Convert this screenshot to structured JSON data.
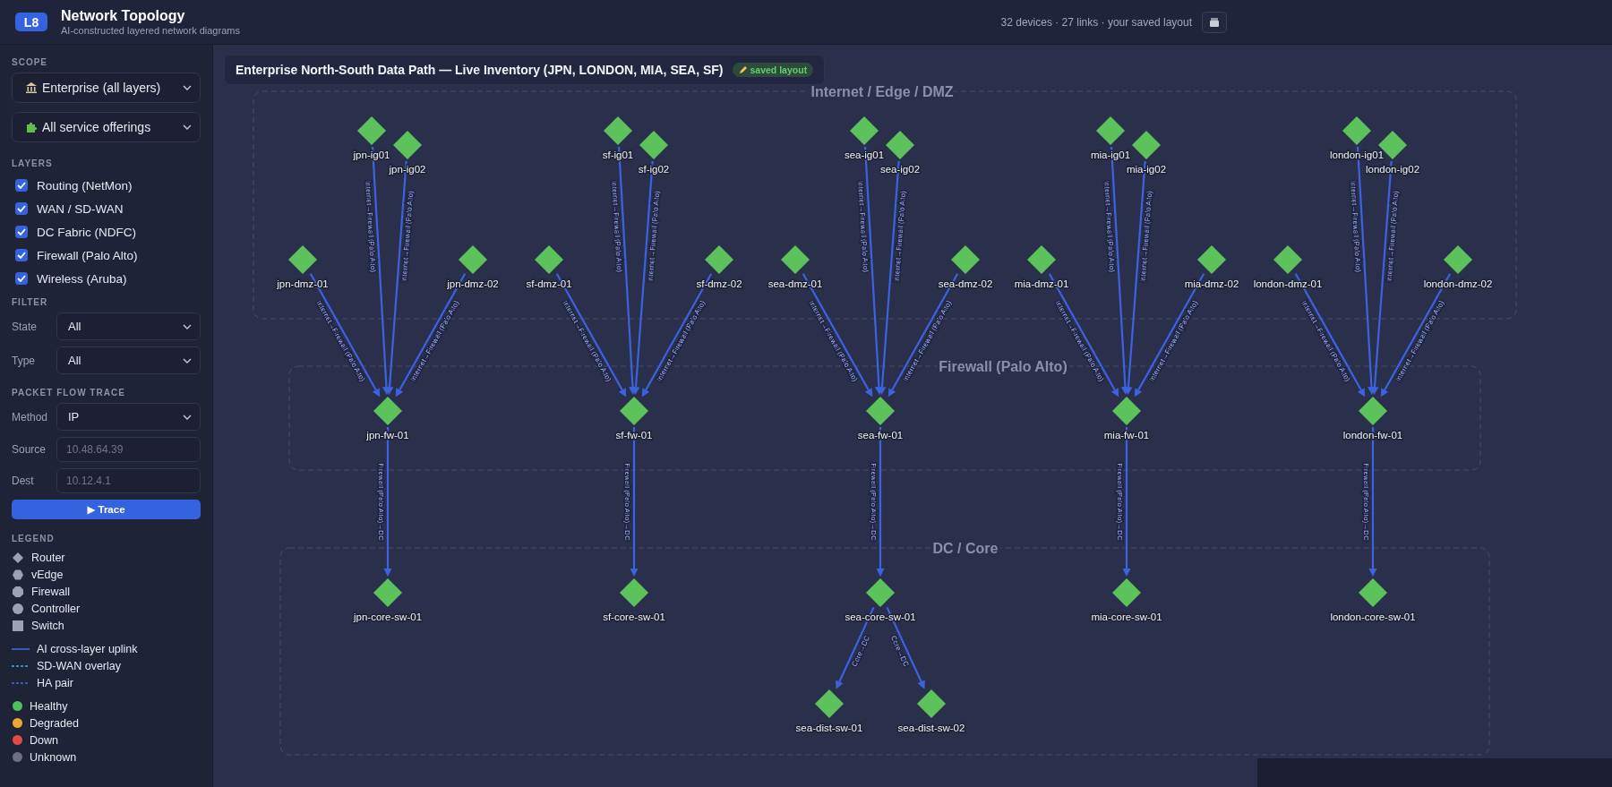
{
  "header": {
    "badge": "L8",
    "title": "Network Topology",
    "subtitle": "AI-constructed layered network diagrams",
    "stats": "32 devices · 27 links · your saved layout"
  },
  "sidebar": {
    "scope": {
      "heading": "SCOPE",
      "dropdowns": [
        {
          "kind": "scope",
          "value": "Enterprise (all layers)"
        },
        {
          "kind": "service",
          "value": "All service offerings"
        }
      ]
    },
    "layers": {
      "heading": "LAYERS",
      "items": [
        {
          "label": "Routing (NetMon)",
          "checked": true
        },
        {
          "label": "WAN / SD-WAN",
          "checked": true
        },
        {
          "label": "DC Fabric (NDFC)",
          "checked": true
        },
        {
          "label": "Firewall (Palo Alto)",
          "checked": true
        },
        {
          "label": "Wireless (Aruba)",
          "checked": true
        }
      ]
    },
    "filter": {
      "heading": "FILTER",
      "fields": [
        {
          "label": "State",
          "value": "All"
        },
        {
          "label": "Type",
          "value": "All"
        }
      ]
    },
    "trace": {
      "heading": "PACKET FLOW TRACE",
      "method": {
        "label": "Method",
        "value": "IP"
      },
      "inputs": [
        {
          "label": "Source",
          "placeholder": "10.48.64.39"
        },
        {
          "label": "Dest",
          "placeholder": "10.12.4.1"
        }
      ],
      "button": "▶ Trace"
    },
    "legend": {
      "heading": "LEGEND",
      "shapes": [
        {
          "kind": "router",
          "label": "Router"
        },
        {
          "kind": "vedge",
          "label": "vEdge"
        },
        {
          "kind": "firewall",
          "label": "Firewall"
        },
        {
          "kind": "controller",
          "label": "Controller"
        },
        {
          "kind": "switch",
          "label": "Switch"
        }
      ],
      "lines": [
        {
          "kind": "uplink",
          "label": "AI cross-layer uplink"
        },
        {
          "kind": "overlay",
          "label": "SD-WAN overlay"
        },
        {
          "kind": "ha",
          "label": "HA pair"
        }
      ],
      "states": [
        {
          "label": "Healthy",
          "color": "#4cc35a"
        },
        {
          "label": "Degraded",
          "color": "#f0a232"
        },
        {
          "label": "Down",
          "color": "#e24b41"
        },
        {
          "label": "Unknown",
          "color": "#6b7183"
        }
      ]
    }
  },
  "canvas": {
    "title": "Enterprise North-South Data Path — Live Inventory (JPN, LONDON, MIA, SEA, SF)",
    "badge": "saved layout",
    "zones": [
      {
        "kind": "edge",
        "title": "Internet / Edge / DMZ"
      },
      {
        "kind": "firewall",
        "title": "Firewall (Palo Alto)"
      },
      {
        "kind": "core",
        "title": "DC / Core"
      }
    ],
    "sites": [
      {
        "firewall": {
          "name": "jpn-fw-01",
          "kind": "fw",
          "color": "#5cc35c",
          "sources": [
            {
              "name": "jpn-ig01",
              "kind": "ig",
              "color": "#5cc35c",
              "link_label": "Internet→Firewall (Palo Alto)"
            },
            {
              "name": "jpn-ig02",
              "kind": "ig",
              "color": "#5cc35c",
              "link_label": "Internet→Firewall (Palo Alto)"
            },
            {
              "name": "jpn-dmz-01",
              "kind": "dmz",
              "color": "#5cc35c",
              "link_label": "Internet→Firewall (Palo Alto)"
            },
            {
              "name": "jpn-dmz-02",
              "kind": "dmz",
              "color": "#5cc35c",
              "link_label": "Internet→Firewall (Palo Alto)"
            }
          ],
          "targets": [
            {
              "name": "jpn-core-sw-01",
              "kind": "core",
              "color": "#5cc35c",
              "link_label": "Firewall (Palo Alto)→DC"
            }
          ]
        }
      },
      {
        "firewall": {
          "name": "sf-fw-01",
          "kind": "fw",
          "color": "#5cc35c",
          "sources": [
            {
              "name": "sf-ig01",
              "kind": "ig",
              "color": "#5cc35c",
              "link_label": "Internet→Firewall (Palo Alto)"
            },
            {
              "name": "sf-ig02",
              "kind": "ig",
              "color": "#5cc35c",
              "link_label": "Internet→Firewall (Palo Alto)"
            },
            {
              "name": "sf-dmz-01",
              "kind": "dmz",
              "color": "#5cc35c",
              "link_label": "Internet→Firewall (Palo Alto)"
            },
            {
              "name": "sf-dmz-02",
              "kind": "dmz",
              "color": "#5cc35c",
              "link_label": "Internet→Firewall (Palo Alto)"
            }
          ],
          "targets": [
            {
              "name": "sf-core-sw-01",
              "kind": "core",
              "color": "#5cc35c",
              "link_label": "Firewall (Palo Alto)→DC"
            }
          ]
        }
      },
      {
        "firewall": {
          "name": "sea-fw-01",
          "kind": "fw",
          "color": "#5cc35c",
          "sources": [
            {
              "name": "sea-ig01",
              "kind": "ig",
              "color": "#5cc35c",
              "link_label": "Internet→Firewall (Palo Alto)"
            },
            {
              "name": "sea-ig02",
              "kind": "ig",
              "color": "#5cc35c",
              "link_label": "Internet→Firewall (Palo Alto)"
            },
            {
              "name": "sea-dmz-01",
              "kind": "dmz",
              "color": "#5cc35c",
              "link_label": "Internet→Firewall (Palo Alto)"
            },
            {
              "name": "sea-dmz-02",
              "kind": "dmz",
              "color": "#5cc35c",
              "link_label": "Internet→Firewall (Palo Alto)"
            }
          ],
          "targets": [
            {
              "name": "sea-core-sw-01",
              "kind": "core",
              "color": "#5cc35c",
              "link_label": "Firewall (Palo Alto)→DC",
              "targets": [
                {
                  "name": "sea-dist-sw-01",
                  "kind": "dist",
                  "color": "#5cc35c",
                  "link_label": "Core→DC"
                },
                {
                  "name": "sea-dist-sw-02",
                  "kind": "dist",
                  "color": "#5cc35c",
                  "link_label": "Core→DC"
                }
              ]
            }
          ]
        }
      },
      {
        "firewall": {
          "name": "mia-fw-01",
          "kind": "fw",
          "color": "#5cc35c",
          "sources": [
            {
              "name": "mia-ig01",
              "kind": "ig",
              "color": "#5cc35c",
              "link_label": "Internet→Firewall (Palo Alto)"
            },
            {
              "name": "mia-ig02",
              "kind": "ig",
              "color": "#5cc35c",
              "link_label": "Internet→Firewall (Palo Alto)"
            },
            {
              "name": "mia-dmz-01",
              "kind": "dmz",
              "color": "#5cc35c",
              "link_label": "Internet→Firewall (Palo Alto)"
            },
            {
              "name": "mia-dmz-02",
              "kind": "dmz",
              "color": "#5cc35c",
              "link_label": "Internet→Firewall (Palo Alto)"
            }
          ],
          "targets": [
            {
              "name": "mia-core-sw-01",
              "kind": "core",
              "color": "#5cc35c",
              "link_label": "Firewall (Palo Alto)→DC"
            }
          ]
        }
      },
      {
        "firewall": {
          "name": "london-fw-01",
          "kind": "fw",
          "color": "#5cc35c",
          "sources": [
            {
              "name": "london-ig01",
              "kind": "ig",
              "color": "#5cc35c",
              "link_label": "Internet→Firewall (Palo Alto)"
            },
            {
              "name": "london-ig02",
              "kind": "ig",
              "color": "#5cc35c",
              "link_label": "Internet→Firewall (Palo Alto)"
            },
            {
              "name": "london-dmz-01",
              "kind": "dmz",
              "color": "#5cc35c",
              "link_label": "Internet→Firewall (Palo Alto)"
            },
            {
              "name": "london-dmz-02",
              "kind": "dmz",
              "color": "#5cc35c",
              "link_label": "Internet→Firewall (Palo Alto)"
            }
          ],
          "targets": [
            {
              "name": "london-core-sw-01",
              "kind": "core",
              "color": "#5cc35c",
              "link_label": "Firewall (Palo Alto)→DC"
            }
          ]
        }
      }
    ]
  }
}
